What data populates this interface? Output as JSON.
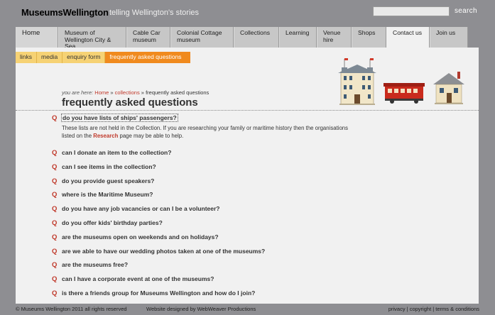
{
  "header": {
    "logo": "MuseumsWellington",
    "tagline": "telling Wellington's stories",
    "search_label": "search",
    "search_value": ""
  },
  "nav": [
    {
      "label": "Home",
      "active": false
    },
    {
      "label": "Museum of Wellington City & Sea",
      "active": false
    },
    {
      "label": "Cable Car museum",
      "active": false
    },
    {
      "label": "Colonial Cottage museum",
      "active": false
    },
    {
      "label": "Collections",
      "active": false
    },
    {
      "label": "Learning",
      "active": false
    },
    {
      "label": "Venue hire",
      "active": false
    },
    {
      "label": "Shops",
      "active": false
    },
    {
      "label": "Contact us",
      "active": true
    },
    {
      "label": "Join us",
      "active": false
    }
  ],
  "subnav": [
    "links",
    "media",
    "enquiry form",
    "frequently asked questions"
  ],
  "breadcrumb": {
    "prefix": "you are here:",
    "home": "Home",
    "sep": "»",
    "collections": "collections",
    "current": "frequently asked questions"
  },
  "page_title": "frequently asked questions",
  "faq": {
    "icon": "Q",
    "first_question": "do you have lists of ships' passengers?",
    "answer_pre": "These lists are not held in the Collection. If you are researching your family or maritime history then the organisations listed on the",
    "answer_link": "Research",
    "answer_post": "page may be able to help.",
    "questions": [
      "can I donate an item to the collection?",
      "can I see items in the collection?",
      "do you provide guest speakers?",
      "where is the Maritime Museum?",
      "do you have any job vacancies or can I be a volunteer?",
      "do you offer kids' birthday parties?",
      "are the museums open on weekends and on holidays?",
      "are we able to have our wedding photos taken at one of the museums?",
      "are the museums free?",
      "can I have a corporate event at one of the museums?",
      "is there a friends group for Museums Wellington and how do I join?"
    ]
  },
  "footer": {
    "copyright": "© Museums Wellington 2011 all rights reserved",
    "designer": "Website designed by WebWeaver Productions",
    "privacy": "privacy",
    "copy": "copyright",
    "terms": "terms & conditions",
    "sep": "|"
  },
  "colors": {
    "background": "#8e8e92",
    "panel": "#f1f1f1",
    "accent": "#c0392b",
    "tab_active": "#f08a1e",
    "tab": "#f6d274"
  }
}
